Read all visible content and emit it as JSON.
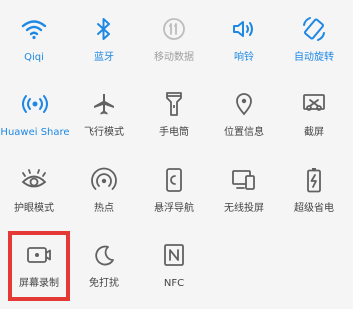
{
  "quick_settings": {
    "tiles": [
      {
        "id": "wifi",
        "label": "Qiqi",
        "icon": "wifi-icon",
        "state": "on"
      },
      {
        "id": "bluetooth",
        "label": "蓝牙",
        "icon": "bluetooth-icon",
        "state": "on"
      },
      {
        "id": "mobile-data",
        "label": "移动数据",
        "icon": "mobile-data-icon",
        "state": "disabled"
      },
      {
        "id": "ring",
        "label": "响铃",
        "icon": "volume-icon",
        "state": "on"
      },
      {
        "id": "auto-rotate",
        "label": "自动旋转",
        "icon": "rotate-icon",
        "state": "on"
      },
      {
        "id": "huawei-share",
        "label": "Huawei Share",
        "icon": "huawei-share-icon",
        "state": "on"
      },
      {
        "id": "airplane",
        "label": "飞行模式",
        "icon": "airplane-icon",
        "state": "off"
      },
      {
        "id": "flashlight",
        "label": "手电筒",
        "icon": "flashlight-icon",
        "state": "off"
      },
      {
        "id": "location",
        "label": "位置信息",
        "icon": "location-icon",
        "state": "off"
      },
      {
        "id": "screenshot",
        "label": "截屏",
        "icon": "screenshot-icon",
        "state": "off"
      },
      {
        "id": "eye-comfort",
        "label": "护眼模式",
        "icon": "eye-icon",
        "state": "off"
      },
      {
        "id": "hotspot",
        "label": "热点",
        "icon": "hotspot-icon",
        "state": "off"
      },
      {
        "id": "floating-nav",
        "label": "悬浮导航",
        "icon": "floating-nav-icon",
        "state": "off"
      },
      {
        "id": "wireless-projection",
        "label": "无线投屏",
        "icon": "projection-icon",
        "state": "off"
      },
      {
        "id": "power-saving",
        "label": "超级省电",
        "icon": "battery-icon",
        "state": "off"
      },
      {
        "id": "screen-recording",
        "label": "屏幕录制",
        "icon": "screen-record-icon",
        "state": "off"
      },
      {
        "id": "do-not-disturb",
        "label": "免打扰",
        "icon": "moon-icon",
        "state": "off"
      },
      {
        "id": "nfc",
        "label": "NFC",
        "icon": "nfc-icon",
        "state": "off"
      }
    ]
  },
  "colors": {
    "active": "#1e88e5",
    "inactive": "#616161",
    "disabled": "#bdbdbd",
    "highlight": "#e53935",
    "background": "#f5f5f5"
  }
}
